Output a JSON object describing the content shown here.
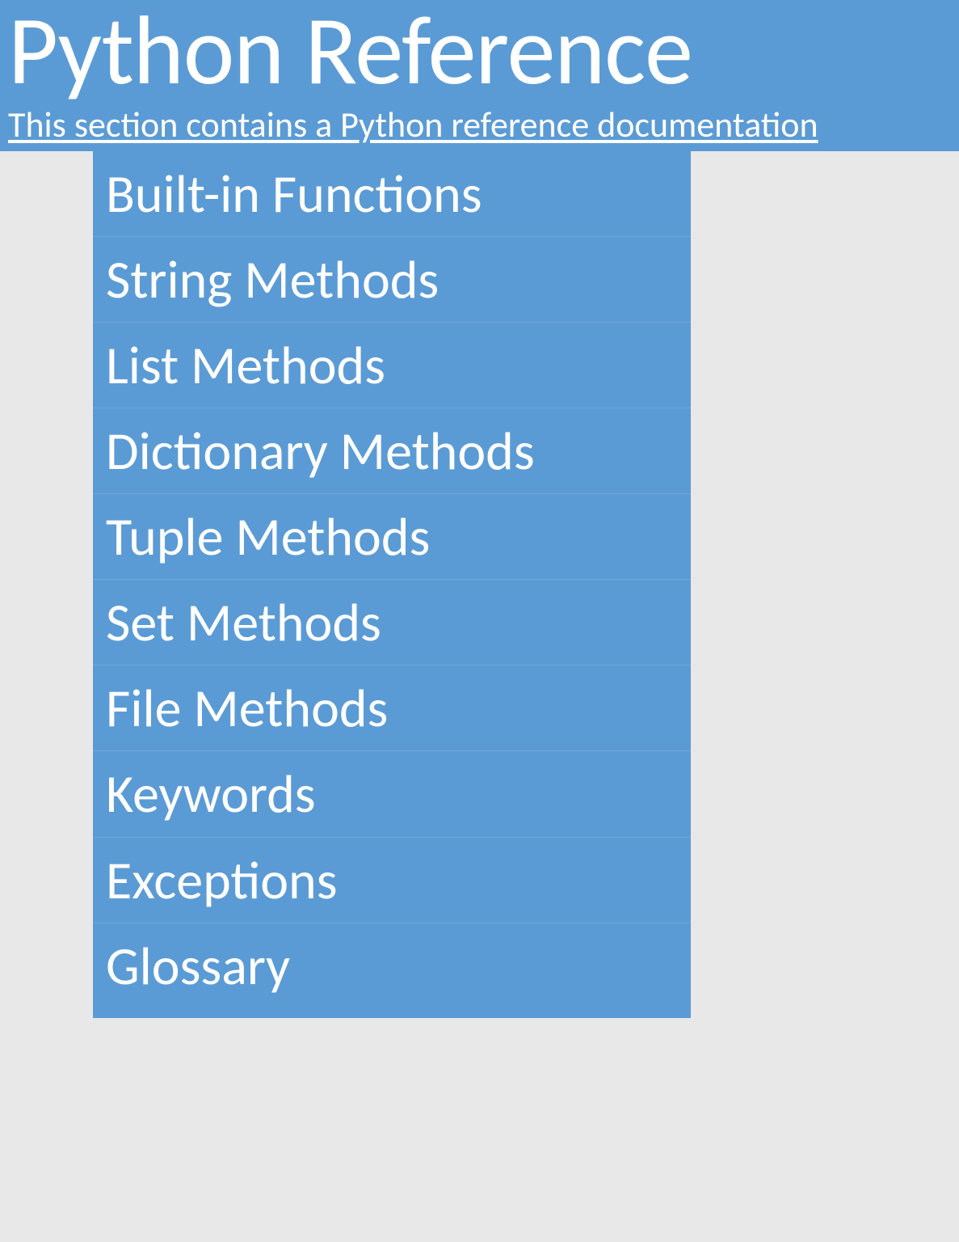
{
  "header": {
    "title": "Python Reference",
    "subtitle": "This section contains a Python reference documentation"
  },
  "items": [
    "Built-in Functions",
    "String Methods",
    "List Methods",
    "Dictionary Methods",
    "Tuple Methods",
    "Set Methods",
    "File Methods",
    "Keywords",
    "Exceptions",
    "Glossary"
  ]
}
